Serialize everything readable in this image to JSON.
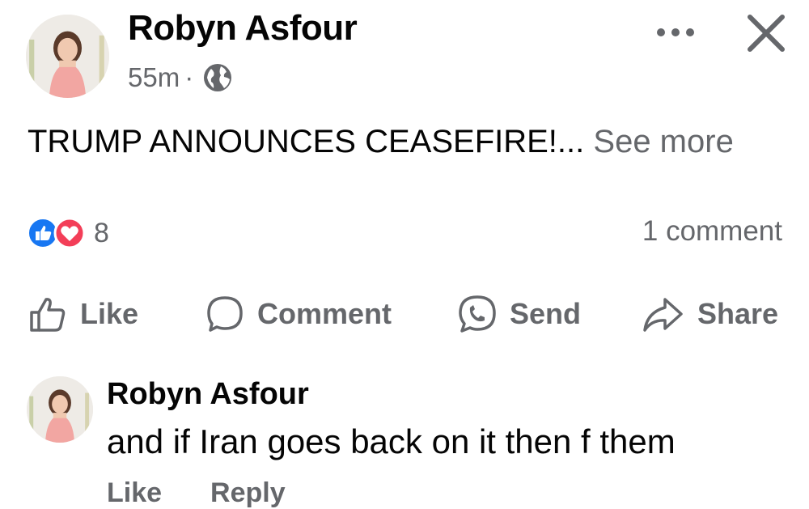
{
  "post": {
    "author": "Robyn Asfour",
    "time": "55m",
    "separator": "·",
    "privacy_icon": "globe-icon",
    "text": "TRUMP ANNOUNCES CEASEFIRE!...",
    "see_more": "See more",
    "reactions": {
      "icons": [
        "like-reaction-icon",
        "love-reaction-icon"
      ],
      "count": "8"
    },
    "comment_count": "1 comment"
  },
  "header_actions": {
    "more_icon": "more-options-icon",
    "close_icon": "close-icon"
  },
  "actions": [
    {
      "label": "Like",
      "icon": "thumbs-up-icon"
    },
    {
      "label": "Comment",
      "icon": "comment-bubble-icon"
    },
    {
      "label": "Send",
      "icon": "messenger-icon"
    },
    {
      "label": "Share",
      "icon": "share-arrow-icon"
    }
  ],
  "comment": {
    "author": "Robyn Asfour",
    "text": "and if Iran goes back on it then f them",
    "actions": [
      "Like",
      "Reply"
    ]
  },
  "colors": {
    "primary_text": "#050505",
    "secondary_text": "#65676b",
    "like_blue": "#1877f2",
    "love_red": "#f33e58"
  }
}
